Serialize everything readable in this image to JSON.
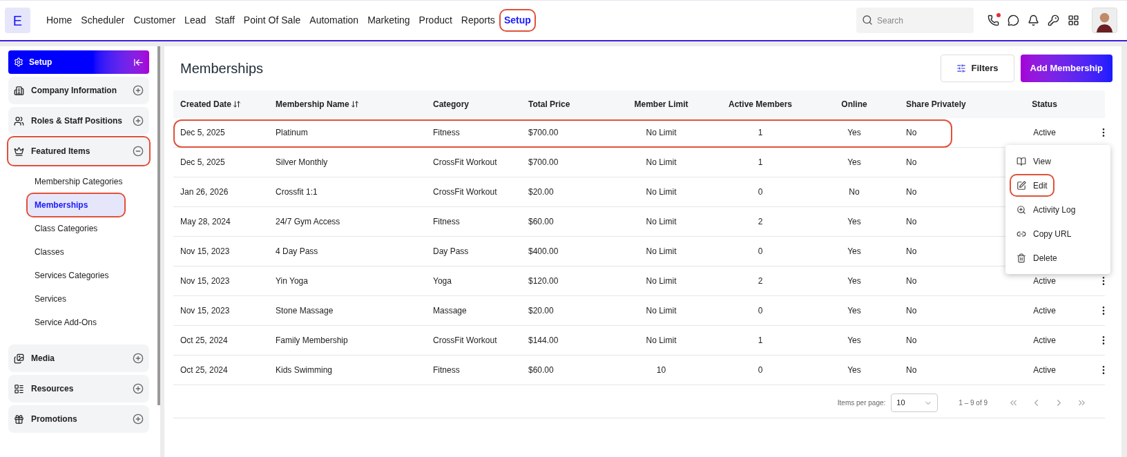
{
  "logo": "E",
  "nav": [
    {
      "label": "Home",
      "selected": false,
      "highlighted": false
    },
    {
      "label": "Scheduler",
      "selected": false,
      "highlighted": false
    },
    {
      "label": "Customer",
      "selected": false,
      "highlighted": false
    },
    {
      "label": "Lead",
      "selected": false,
      "highlighted": false
    },
    {
      "label": "Staff",
      "selected": false,
      "highlighted": false
    },
    {
      "label": "Point Of Sale",
      "selected": false,
      "highlighted": false
    },
    {
      "label": "Automation",
      "selected": false,
      "highlighted": false
    },
    {
      "label": "Marketing",
      "selected": false,
      "highlighted": false
    },
    {
      "label": "Product",
      "selected": false,
      "highlighted": false
    },
    {
      "label": "Reports",
      "selected": false,
      "highlighted": false
    },
    {
      "label": "Setup",
      "selected": true,
      "highlighted": true
    }
  ],
  "search": {
    "placeholder": "Search"
  },
  "call_alert": true,
  "sidebar": {
    "title": "Setup",
    "sections": [
      {
        "label": "Company Information",
        "expanded": false,
        "highlighted": false
      },
      {
        "label": "Roles & Staff Positions",
        "expanded": false,
        "highlighted": false
      },
      {
        "label": "Featured Items",
        "expanded": true,
        "highlighted": true,
        "children": [
          {
            "label": "Membership Categories",
            "selected": false,
            "highlighted": false
          },
          {
            "label": "Memberships",
            "selected": true,
            "highlighted": true
          },
          {
            "label": "Class Categories",
            "selected": false,
            "highlighted": false
          },
          {
            "label": "Classes",
            "selected": false,
            "highlighted": false
          },
          {
            "label": "Services Categories",
            "selected": false,
            "highlighted": false
          },
          {
            "label": "Services",
            "selected": false,
            "highlighted": false
          },
          {
            "label": "Service Add-Ons",
            "selected": false,
            "highlighted": false
          }
        ]
      },
      {
        "label": "Media",
        "expanded": false,
        "highlighted": false
      },
      {
        "label": "Resources",
        "expanded": false,
        "highlighted": false
      },
      {
        "label": "Promotions",
        "expanded": false,
        "highlighted": false
      }
    ]
  },
  "page_title": "Memberships",
  "buttons": {
    "filters": "Filters",
    "add": "Add Membership"
  },
  "table": {
    "columns": [
      {
        "label": "Created Date",
        "sortable": true
      },
      {
        "label": "Membership Name",
        "sortable": true
      },
      {
        "label": "Category",
        "sortable": false
      },
      {
        "label": "Total Price",
        "sortable": false
      },
      {
        "label": "Member Limit",
        "sortable": false
      },
      {
        "label": "Active Members",
        "sortable": false
      },
      {
        "label": "Online",
        "sortable": false
      },
      {
        "label": "Share Privately",
        "sortable": false
      },
      {
        "label": "Status",
        "sortable": false
      }
    ],
    "rows": [
      {
        "cells": [
          "Dec 5, 2025",
          "Platinum",
          "Fitness",
          "$700.00",
          "No Limit",
          "1",
          "Yes",
          "No",
          "Active"
        ],
        "highlighted": true
      },
      {
        "cells": [
          "Dec 5, 2025",
          "Silver Monthly",
          "CrossFit Workout",
          "$700.00",
          "No Limit",
          "1",
          "Yes",
          "No"
        ],
        "highlighted": false
      },
      {
        "cells": [
          "Jan 26, 2026",
          "Crossfit 1:1",
          "CrossFit Workout",
          "$20.00",
          "No Limit",
          "0",
          "No",
          "No"
        ],
        "highlighted": false
      },
      {
        "cells": [
          "May 28, 2024",
          "24/7 Gym Access",
          "Fitness",
          "$60.00",
          "No Limit",
          "2",
          "Yes",
          "No"
        ],
        "highlighted": false
      },
      {
        "cells": [
          "Nov 15, 2023",
          "4 Day Pass",
          "Day Pass",
          "$400.00",
          "No Limit",
          "0",
          "Yes",
          "No"
        ],
        "highlighted": false
      },
      {
        "cells": [
          "Nov 15, 2023",
          "Yin Yoga",
          "Yoga",
          "$120.00",
          "No Limit",
          "2",
          "Yes",
          "No",
          "Active"
        ],
        "highlighted": false
      },
      {
        "cells": [
          "Nov 15, 2023",
          "Stone Massage",
          "Massage",
          "$20.00",
          "No Limit",
          "0",
          "Yes",
          "No",
          "Active"
        ],
        "highlighted": false
      },
      {
        "cells": [
          "Oct 25, 2024",
          "Family Membership",
          "CrossFit Workout",
          "$144.00",
          "No Limit",
          "1",
          "Yes",
          "No",
          "Active"
        ],
        "highlighted": false
      },
      {
        "cells": [
          "Oct 25, 2024",
          "Kids Swimming",
          "Fitness",
          "$60.00",
          "10",
          "0",
          "Yes",
          "No",
          "Active"
        ],
        "highlighted": false
      }
    ]
  },
  "row_menu": [
    {
      "label": "View",
      "highlighted": false
    },
    {
      "label": "Edit",
      "highlighted": true
    },
    {
      "label": "Activity Log",
      "highlighted": false
    },
    {
      "label": "Copy URL",
      "highlighted": false
    },
    {
      "label": "Delete",
      "highlighted": false
    }
  ],
  "pagination": {
    "label": "Items per page:",
    "page_size": "10",
    "range": "1 – 9 of 9"
  }
}
